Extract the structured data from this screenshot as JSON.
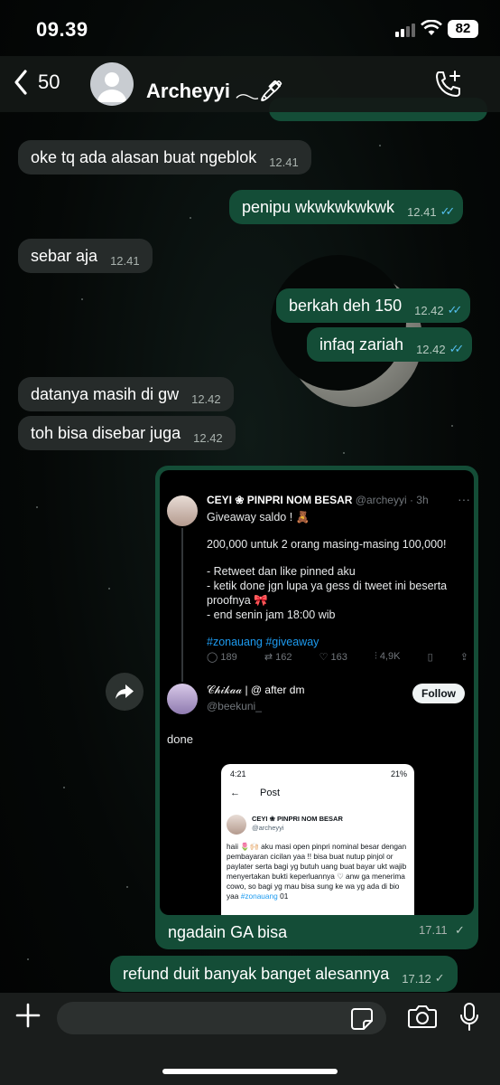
{
  "status_bar": {
    "time": "09.39",
    "battery": "82"
  },
  "header": {
    "back_count": "50",
    "contact_name": "Archeyyi 𓂃🖊"
  },
  "messages": [
    {
      "text": "oke tq ada alasan buat ngeblok",
      "time": "12.41"
    },
    {
      "text": "penipu wkwkwkwkwk",
      "time": "12.41",
      "status": "✓✓"
    },
    {
      "text": "sebar aja",
      "time": "12.41"
    },
    {
      "text": "berkah deh 150",
      "time": "12.42",
      "status": "✓✓"
    },
    {
      "text": "infaq zariah",
      "time": "12.42",
      "status": "✓✓"
    },
    {
      "text": "datanya masih di gw",
      "time": "12.42"
    },
    {
      "text": "toh bisa disebar juga",
      "time": "12.42"
    },
    {
      "text": "ngadain GA bisa",
      "time": "17.11",
      "status": "✓"
    },
    {
      "text": "refund duit banyak banget alesannya",
      "time": "17.12",
      "status": "✓"
    }
  ],
  "screenshot": {
    "tweet": {
      "name": "CEYI ❀ PINPRI NOM BESAR",
      "handle": "@archeyyi · 3h",
      "line1": "Giveaway saldo ! 🧸",
      "line2": "200,000 untuk 2 orang masing-masing 100,000!",
      "line3": "- Retweet dan like pinned aku",
      "line4": "- ketik done jgn lupa ya gess di tweet ini beserta proofnya 🎀",
      "line5": "- end senin jam 18:00 wib",
      "tags": "#zonauang #giveaway",
      "replies": "189",
      "retweets": "162",
      "likes": "163",
      "views": "4,9K"
    },
    "reply": {
      "name": "𝒞𝒽𝒾𝓀𝒶𝒶 | @ after dm",
      "handle": "@beekuni_",
      "follow_label": "Follow",
      "text": "done"
    },
    "phone": {
      "time": "4:21",
      "battery": "21%",
      "title": "Post",
      "name": "CEYI ❀ PINPRI NOM BESAR",
      "handle": "@archeyyi",
      "text": "haii 🌷🙌🏻 aku masi open pinpri nominal besar dengan pembayaran cicilan yaa !! bisa buat nutup pinjol or paylater serta bagi yg butuh uang buat bayar ukt wajib menyertakan bukti keperluannya ♡ anw ga menerima cowo, so bagi yg mau bisa sung ke wa yg ada di bio yaa",
      "tag": "#zonauang",
      "tag_suffix": " 01"
    }
  },
  "composer": {
    "placeholder": ""
  }
}
